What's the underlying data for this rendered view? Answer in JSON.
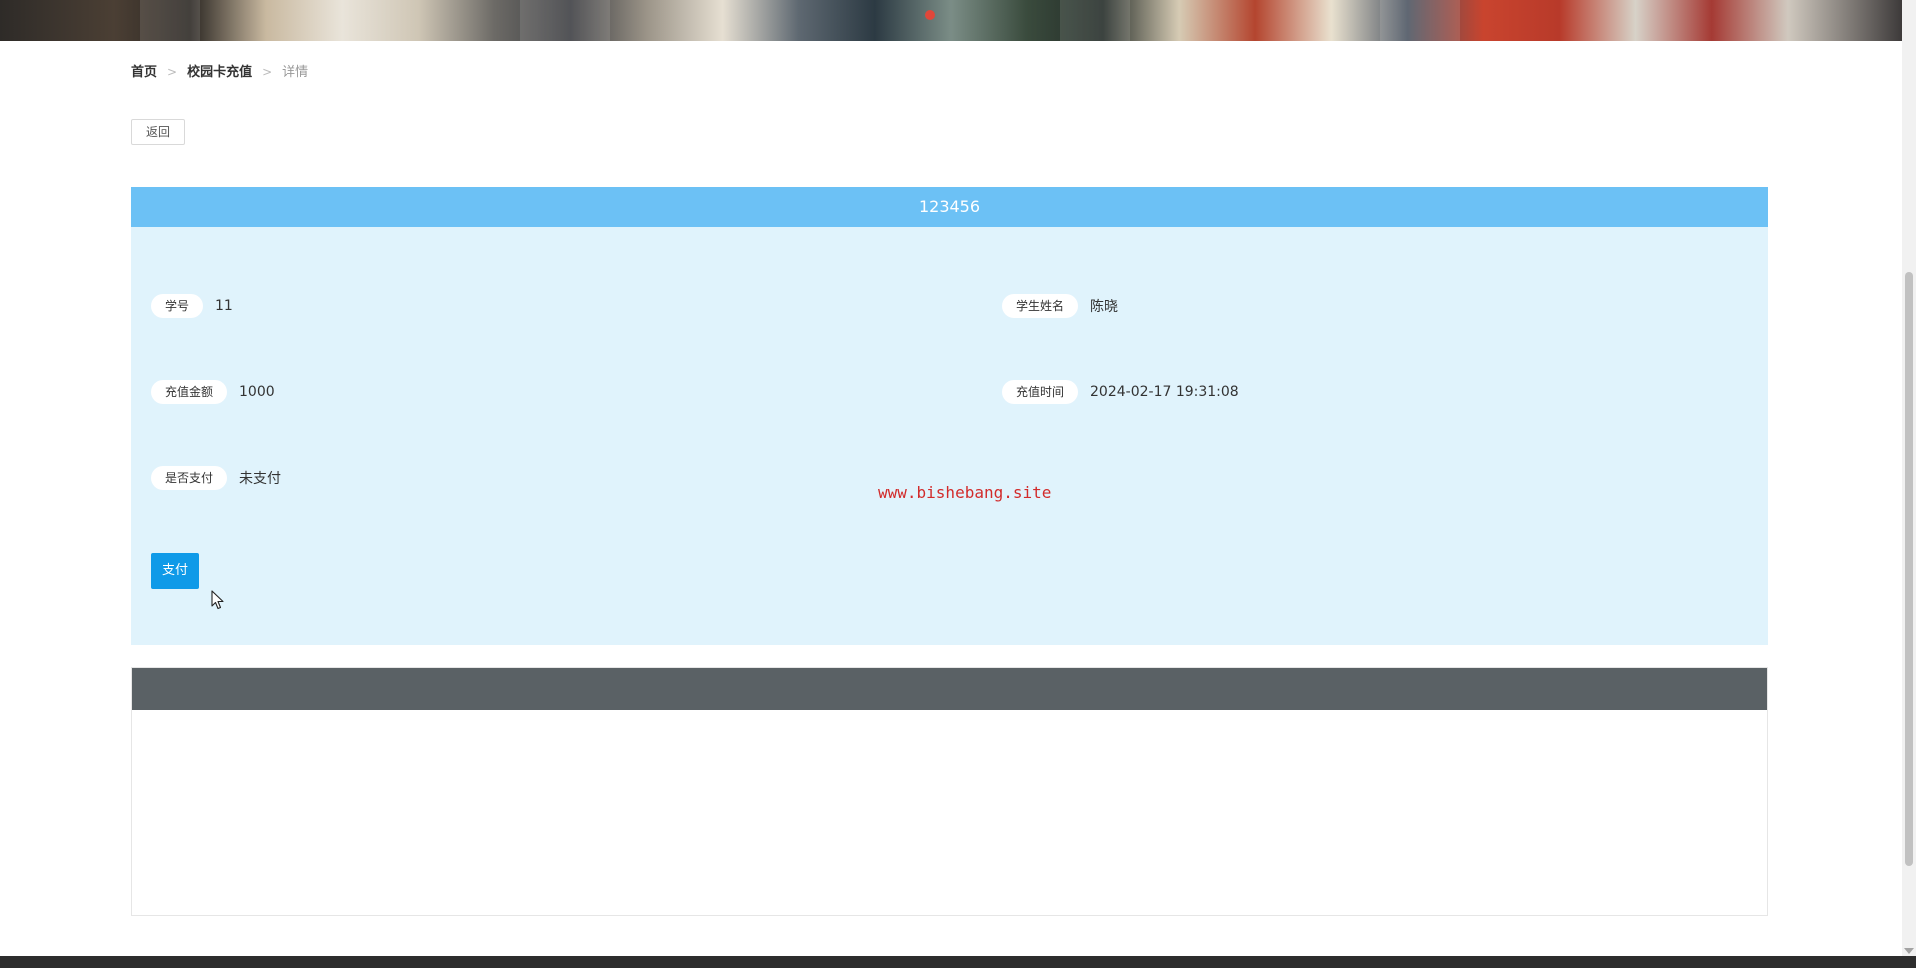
{
  "breadcrumb": {
    "items": [
      "首页",
      "校园卡充值",
      "详情"
    ],
    "separator": ">"
  },
  "toolbar": {
    "back_label": "返回"
  },
  "detail": {
    "title": "123456",
    "fields": {
      "student_id": {
        "label": "学号",
        "value": "11"
      },
      "student_name": {
        "label": "学生姓名",
        "value": "陈晓"
      },
      "amount": {
        "label": "充值金额",
        "value": "1000"
      },
      "recharge_time": {
        "label": "充值时间",
        "value": "2024-02-17 19:31:08"
      },
      "paid": {
        "label": "是否支付",
        "value": "未支付"
      }
    },
    "pay_label": "支付"
  },
  "watermark": "www.bishebang.site",
  "colors": {
    "card_header": "#6cc1f5",
    "card_background": "#e0f3fc",
    "pay_button": "#0f9ae8",
    "panel_header": "#5a6165",
    "watermark": "#d22b2b",
    "active_slide_dot": "#e0473a"
  }
}
